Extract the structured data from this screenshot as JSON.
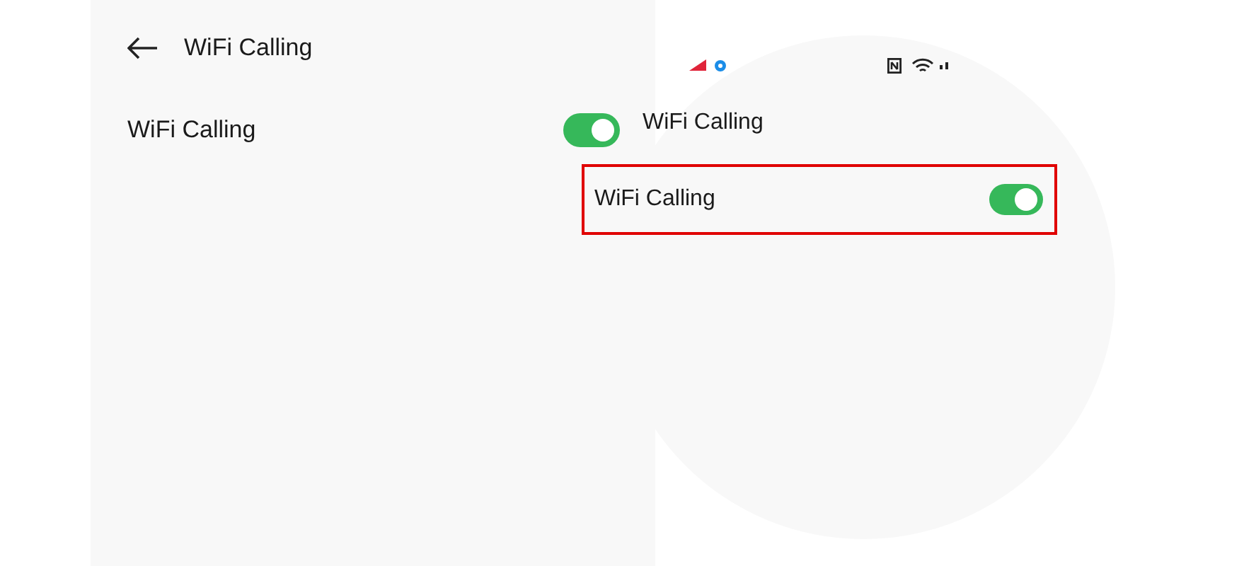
{
  "screen": {
    "title": "WiFi Calling"
  },
  "settings": [
    {
      "label": "WiFi Calling",
      "on": true
    }
  ],
  "magnifier": {
    "title": "WiFi Calling",
    "row": {
      "label": "WiFi Calling",
      "on": true
    }
  }
}
